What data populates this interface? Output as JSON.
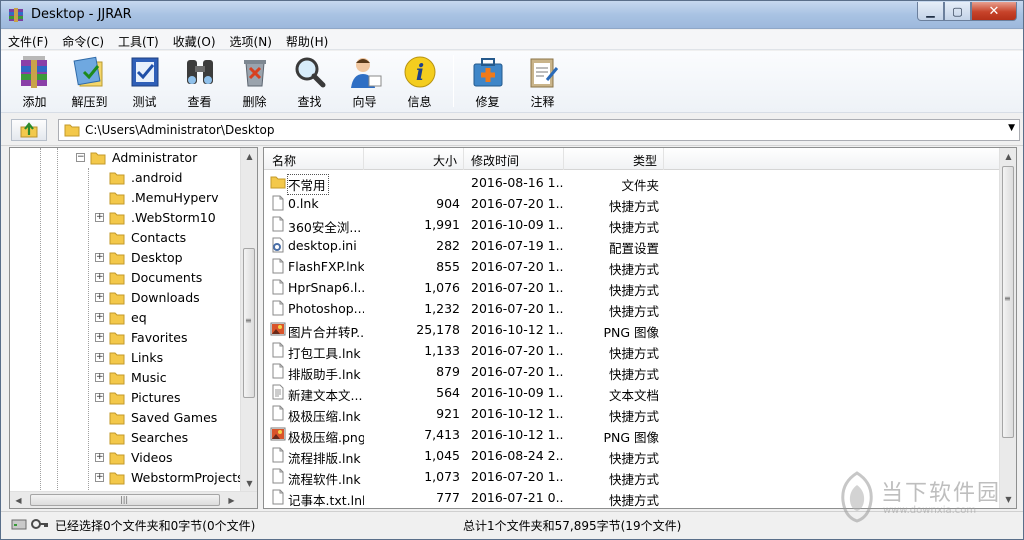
{
  "window": {
    "title": "Desktop - JJRAR"
  },
  "menu": [
    "文件(F)",
    "命令(C)",
    "工具(T)",
    "收藏(O)",
    "选项(N)",
    "帮助(H)"
  ],
  "toolbar": [
    {
      "label": "添加",
      "icon": "add-archive-icon"
    },
    {
      "label": "解压到",
      "icon": "extract-icon"
    },
    {
      "label": "测试",
      "icon": "test-icon"
    },
    {
      "label": "查看",
      "icon": "view-icon"
    },
    {
      "label": "删除",
      "icon": "delete-icon"
    },
    {
      "label": "查找",
      "icon": "find-icon"
    },
    {
      "label": "向导",
      "icon": "wizard-icon"
    },
    {
      "label": "信息",
      "icon": "info-icon"
    },
    {
      "label": "修复",
      "icon": "repair-icon"
    },
    {
      "label": "注释",
      "icon": "comment-icon"
    }
  ],
  "address": {
    "path": "C:\\Users\\Administrator\\Desktop"
  },
  "tree": {
    "root": "Administrator",
    "items": [
      ".android",
      ".MemuHyperv",
      ".WebStorm10",
      "Contacts",
      "Desktop",
      "Documents",
      "Downloads",
      "eq",
      "Favorites",
      "Links",
      "Music",
      "Pictures",
      "Saved Games",
      "Searches",
      "Videos",
      "WebstormProjects"
    ]
  },
  "columns": {
    "name": "名称",
    "size": "大小",
    "modified": "修改时间",
    "type": "类型"
  },
  "files": [
    {
      "name": "不常用",
      "size": "",
      "modified": "2016-08-16 1...",
      "type": "文件夹",
      "icon": "folder-icon"
    },
    {
      "name": "0.lnk",
      "size": "904",
      "modified": "2016-07-20 1...",
      "type": "快捷方式",
      "icon": "file-icon"
    },
    {
      "name": "360安全浏...",
      "size": "1,991",
      "modified": "2016-10-09 1...",
      "type": "快捷方式",
      "icon": "file-icon"
    },
    {
      "name": "desktop.ini",
      "size": "282",
      "modified": "2016-07-19 1...",
      "type": "配置设置",
      "icon": "settings-file-icon"
    },
    {
      "name": "FlashFXP.lnk",
      "size": "855",
      "modified": "2016-07-20 1...",
      "type": "快捷方式",
      "icon": "file-icon"
    },
    {
      "name": "HprSnap6.l...",
      "size": "1,076",
      "modified": "2016-07-20 1...",
      "type": "快捷方式",
      "icon": "file-icon"
    },
    {
      "name": "Photoshop....",
      "size": "1,232",
      "modified": "2016-07-20 1...",
      "type": "快捷方式",
      "icon": "file-icon"
    },
    {
      "name": "图片合并转P...",
      "size": "25,178",
      "modified": "2016-10-12 1...",
      "type": "PNG 图像",
      "icon": "image-file-icon"
    },
    {
      "name": "打包工具.lnk",
      "size": "1,133",
      "modified": "2016-07-20 1...",
      "type": "快捷方式",
      "icon": "file-icon"
    },
    {
      "name": "排版助手.lnk",
      "size": "879",
      "modified": "2016-07-20 1...",
      "type": "快捷方式",
      "icon": "file-icon"
    },
    {
      "name": "新建文本文...",
      "size": "564",
      "modified": "2016-10-09 1...",
      "type": "文本文档",
      "icon": "text-file-icon"
    },
    {
      "name": "极极压缩.lnk",
      "size": "921",
      "modified": "2016-10-12 1...",
      "type": "快捷方式",
      "icon": "file-icon"
    },
    {
      "name": "极极压缩.png",
      "size": "7,413",
      "modified": "2016-10-12 1...",
      "type": "PNG 图像",
      "icon": "image-file-icon"
    },
    {
      "name": "流程排版.lnk",
      "size": "1,045",
      "modified": "2016-08-24 2...",
      "type": "快捷方式",
      "icon": "file-icon"
    },
    {
      "name": "流程软件.lnk",
      "size": "1,073",
      "modified": "2016-07-20 1...",
      "type": "快捷方式",
      "icon": "file-icon"
    },
    {
      "name": "记事本.txt.lnk",
      "size": "777",
      "modified": "2016-07-21 0...",
      "type": "快捷方式",
      "icon": "file-icon"
    }
  ],
  "status": {
    "left": "已经选择0个文件夹和0字节(0个文件)",
    "right": "总计1个文件夹和57,895字节(19个文件)"
  },
  "watermark": {
    "title": "当下软件园",
    "url": "www.downxia.com"
  }
}
